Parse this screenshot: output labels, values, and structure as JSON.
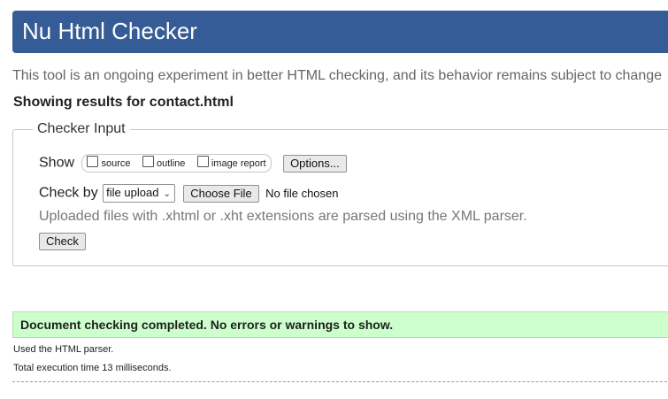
{
  "header": {
    "title": "Nu Html Checker"
  },
  "tagline": "This tool is an ongoing experiment in better HTML checking, and its behavior remains subject to change",
  "results_for": "Showing results for contact.html",
  "checker": {
    "legend": "Checker Input",
    "show_label": "Show",
    "show_options": [
      {
        "label": "source",
        "checked": false
      },
      {
        "label": "outline",
        "checked": false
      },
      {
        "label": "image report",
        "checked": false
      }
    ],
    "options_button": "Options...",
    "check_by_label": "Check by",
    "check_by_selected": "file upload",
    "choose_file_button": "Choose File",
    "no_file_text": "No file chosen",
    "parser_note": "Uploaded files with .xhtml or .xht extensions are parsed using the XML parser.",
    "check_button": "Check"
  },
  "result": {
    "message": "Document checking completed. No errors or warnings to show.",
    "parser_used": "Used the HTML parser.",
    "execution_time": "Total execution time 13 milliseconds."
  },
  "colors": {
    "header_bg": "#355c96",
    "success_bg": "#ccffcc"
  }
}
